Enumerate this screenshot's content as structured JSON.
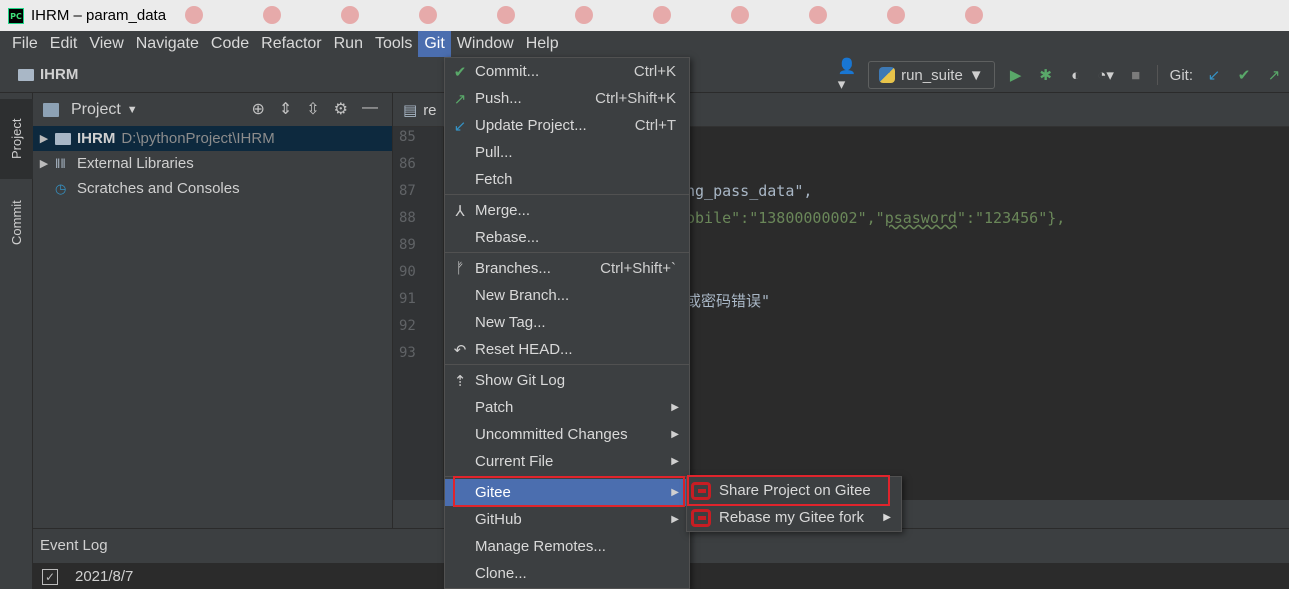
{
  "window": {
    "title": "IHRM – param_data",
    "app_icon": "PC"
  },
  "menubar": [
    "File",
    "Edit",
    "View",
    "Navigate",
    "Code",
    "Refactor",
    "Run",
    "Tools",
    "Git",
    "Window",
    "Help"
  ],
  "navbar": {
    "breadcrumb": "IHRM",
    "run_config": "run_suite",
    "git_label": "Git:"
  },
  "side_tabs": {
    "project": "Project",
    "commit": "Commit"
  },
  "project_panel": {
    "title": "Project",
    "tree": [
      {
        "name": "IHRM",
        "path": "D:\\pythonProject\\IHRM"
      },
      {
        "name": "External Libraries"
      },
      {
        "name": "Scratches and Consoles"
      }
    ]
  },
  "editor": {
    "tab_label": "re",
    "line_numbers": [
      "85",
      "86",
      "87",
      "88",
      "89",
      "90",
      "91",
      "92",
      "93"
    ],
    "code_line_87": "ng_pass_data\",",
    "code_line_88": {
      "a": "obile\":\"13800000002\",\"",
      "b": "psasword",
      "c": "\":\"123456\"},"
    },
    "code_line_91": "或密码错误\""
  },
  "event_log": {
    "title": "Event Log",
    "date": "2021/8/7"
  },
  "git_menu": {
    "items": [
      {
        "label": "Commit...",
        "shortcut": "Ctrl+K",
        "icon": "check-icon"
      },
      {
        "label": "Push...",
        "shortcut": "Ctrl+Shift+K",
        "icon": "push-arrow-icon"
      },
      {
        "label": "Update Project...",
        "shortcut": "Ctrl+T",
        "icon": "update-arrow-icon"
      },
      {
        "label": "Pull..."
      },
      {
        "label": "Fetch"
      },
      {
        "label": "Merge...",
        "icon": "merge-icon"
      },
      {
        "label": "Rebase..."
      },
      {
        "label": "Branches...",
        "shortcut": "Ctrl+Shift+`",
        "icon": "branch-icon"
      },
      {
        "label": "New Branch..."
      },
      {
        "label": "New Tag..."
      },
      {
        "label": "Reset HEAD...",
        "icon": "undo-icon"
      },
      {
        "label": "Show Git Log",
        "icon": "git-log-icon"
      },
      {
        "label": "Patch"
      },
      {
        "label": "Uncommitted Changes"
      },
      {
        "label": "Current File"
      },
      {
        "label": "Gitee"
      },
      {
        "label": "GitHub"
      },
      {
        "label": "Manage Remotes..."
      },
      {
        "label": "Clone..."
      }
    ]
  },
  "gitee_submenu": {
    "items": [
      {
        "label": "Share Project on Gitee"
      },
      {
        "label": "Rebase my Gitee fork"
      }
    ]
  },
  "colors": {
    "highlight": "#4b6eaf",
    "annotation_red": "#e0242c",
    "gitee_red": "#c71d23"
  }
}
